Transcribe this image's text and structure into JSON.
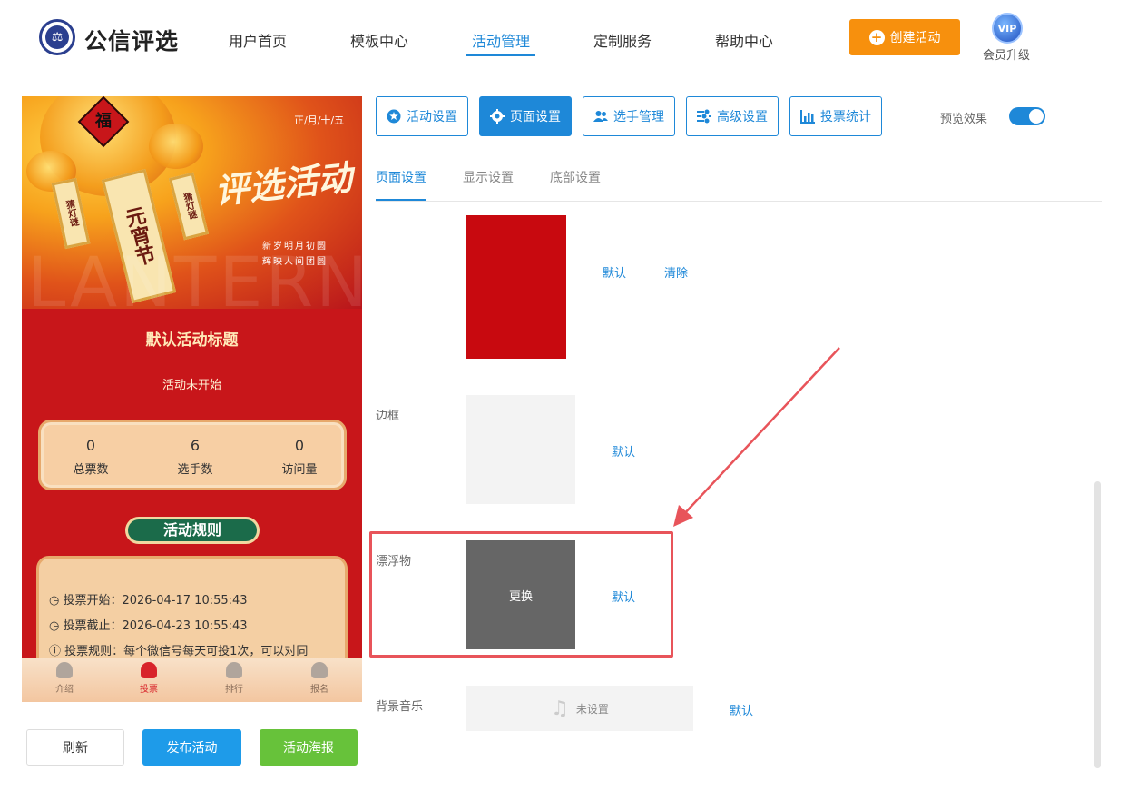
{
  "header": {
    "logo_text": "公信评选",
    "nav": [
      "用户首页",
      "模板中心",
      "活动管理",
      "定制服务",
      "帮助中心"
    ],
    "active_nav": "活动管理",
    "create_button": "创建活动",
    "vip_badge": "VIP",
    "vip_label": "会员升级"
  },
  "preview": {
    "banner": {
      "fu": "福",
      "date": "正/月/十/五",
      "title": "评选活动",
      "tag_center": "元宵节",
      "tag_left": "猜灯谜",
      "tag_right": "猜灯谜",
      "poem_line1": "新岁明月初圆",
      "poem_line2": "辉映人间团圆",
      "watermark": "LANTERN"
    },
    "activity_title": "默认活动标题",
    "status": "活动未开始",
    "stats": [
      {
        "value": "0",
        "label": "总票数"
      },
      {
        "value": "6",
        "label": "选手数"
      },
      {
        "value": "0",
        "label": "访问量"
      }
    ],
    "rules_title": "活动规则",
    "rules": [
      "投票开始：2026-04-17 10:55:43",
      "投票截止：2026-04-23 10:55:43",
      "投票规则：每个微信号每天可投1次，可以对同"
    ],
    "tabbar": [
      "介绍",
      "投票",
      "排行",
      "报名"
    ],
    "active_tab": "投票"
  },
  "actions": {
    "refresh": "刷新",
    "publish": "发布活动",
    "poster": "活动海报"
  },
  "settings": {
    "tabs": [
      {
        "label": "活动设置",
        "icon": "star-icon"
      },
      {
        "label": "页面设置",
        "icon": "gear-icon"
      },
      {
        "label": "选手管理",
        "icon": "users-icon"
      },
      {
        "label": "高级设置",
        "icon": "sliders-icon"
      },
      {
        "label": "投票统计",
        "icon": "bar-chart-icon"
      }
    ],
    "active_tab": "页面设置",
    "preview_label": "预览效果",
    "preview_enabled": true,
    "subtabs": [
      "页面设置",
      "显示设置",
      "底部设置"
    ],
    "active_subtab": "页面设置",
    "background": {
      "color": "#c8090f",
      "default": "默认",
      "clear": "清除"
    },
    "border": {
      "label": "边框",
      "default": "默认"
    },
    "floating": {
      "label": "漂浮物",
      "replace": "更换",
      "default": "默认"
    },
    "music": {
      "label": "背景音乐",
      "value": "未设置",
      "default": "默认"
    }
  },
  "colors": {
    "accent": "#1e88d8",
    "orange": "#f7900d",
    "green": "#67c23a",
    "highlight": "#e8545a"
  }
}
